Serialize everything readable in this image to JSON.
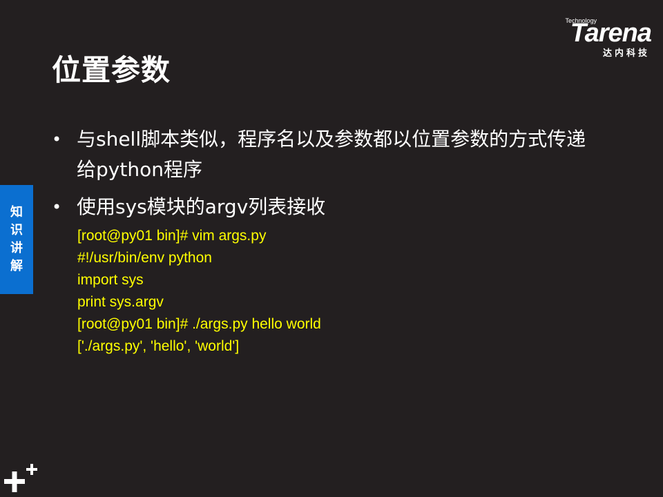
{
  "slide": {
    "title": "位置参数",
    "side_tab": "知识讲解",
    "logo": {
      "technology": "Technology",
      "name": "Tarena",
      "chinese": "达内科技"
    },
    "bullets": [
      "与shell脚本类似，程序名以及参数都以位置参数的方式传递给python程序",
      "使用sys模块的argv列表接收"
    ],
    "code_lines": [
      "[root@py01 bin]# vim args.py",
      "#!/usr/bin/env python",
      "import sys",
      "print sys.argv",
      "[root@py01 bin]# ./args.py hello world",
      "['./args.py', 'hello', 'world']"
    ],
    "colors": {
      "background": "#231f20",
      "text": "#ffffff",
      "code": "#ffff00",
      "side_tab": "#0b6fd0"
    },
    "icons": {
      "bullet": "bullet-dot-icon",
      "corner": "plus-plus-icon"
    }
  }
}
